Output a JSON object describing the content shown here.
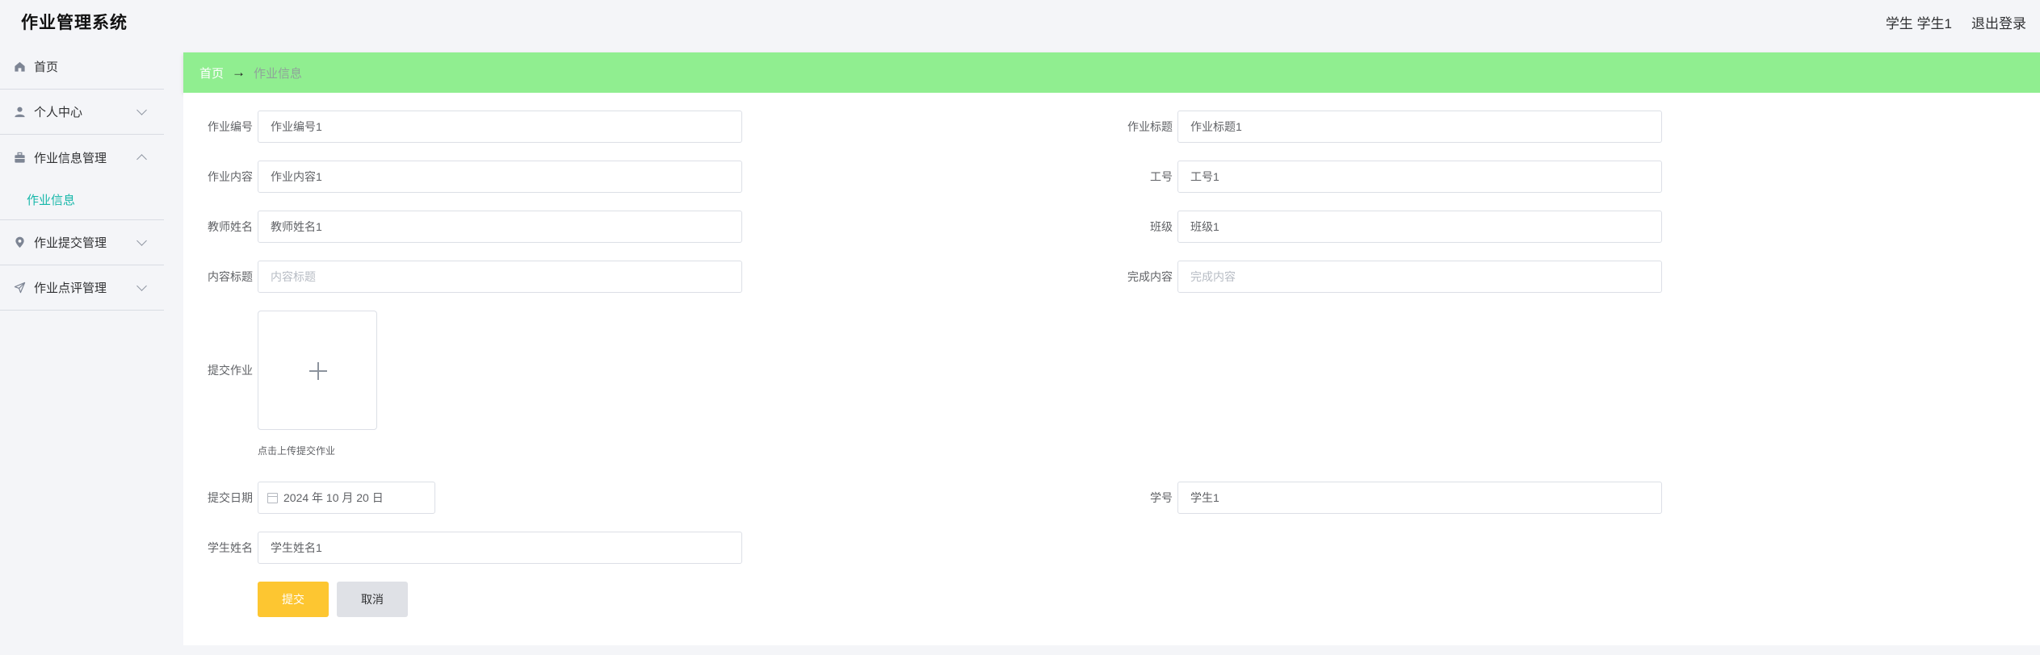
{
  "header": {
    "title": "作业管理系统",
    "user": "学生 学生1",
    "logout": "退出登录"
  },
  "sidebar": {
    "items": [
      {
        "label": "首页",
        "icon": "home-icon"
      },
      {
        "label": "个人中心",
        "icon": "user-icon",
        "expanded": false
      },
      {
        "label": "作业信息管理",
        "icon": "briefcase-icon",
        "expanded": true,
        "children": [
          {
            "label": "作业信息",
            "active": true
          }
        ]
      },
      {
        "label": "作业提交管理",
        "icon": "location-icon",
        "expanded": false
      },
      {
        "label": "作业点评管理",
        "icon": "send-icon",
        "expanded": false
      }
    ]
  },
  "breadcrumb": {
    "home": "首页",
    "separator": "→",
    "current": "作业信息"
  },
  "form": {
    "hw_no": {
      "label": "作业编号",
      "value": "作业编号1"
    },
    "hw_title": {
      "label": "作业标题",
      "value": "作业标题1"
    },
    "hw_content": {
      "label": "作业内容",
      "value": "作业内容1"
    },
    "staff_no": {
      "label": "工号",
      "value": "工号1"
    },
    "teacher_name": {
      "label": "教师姓名",
      "value": "教师姓名1"
    },
    "class_name": {
      "label": "班级",
      "value": "班级1"
    },
    "content_title": {
      "label": "内容标题",
      "value": "",
      "placeholder": "内容标题"
    },
    "done_content": {
      "label": "完成内容",
      "value": "",
      "placeholder": "完成内容"
    },
    "submit_file": {
      "label": "提交作业",
      "tip": "点击上传提交作业"
    },
    "submit_date": {
      "label": "提交日期",
      "value": "2024 年 10 月 20 日"
    },
    "student_no": {
      "label": "学号",
      "value": "学生1"
    },
    "student_name": {
      "label": "学生姓名",
      "value": "学生姓名1"
    },
    "submit_button": "提交",
    "cancel_button": "取消"
  },
  "colors": {
    "breadcrumb_bg": "#90ee90",
    "active_menu": "#16b7a9",
    "submit_button": "#fdc631",
    "cancel_button": "#dfe1e6"
  }
}
